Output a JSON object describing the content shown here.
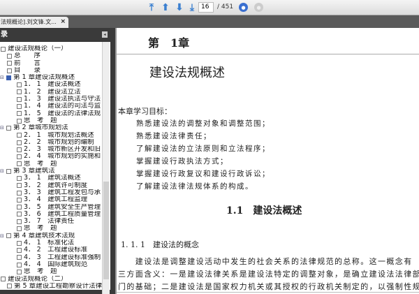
{
  "toolbar": {
    "page_current": "16",
    "page_total": "/ 451",
    "icons": [
      "first-page-icon",
      "prev-page-icon",
      "next-page-icon",
      "last-page-icon",
      "go-icon",
      "disabled-go-icon"
    ]
  },
  "tab": {
    "title": "法规概论].刘文锋.文...",
    "close": "×"
  },
  "sidebar": {
    "title": "录",
    "collapse": "◂",
    "items": [
      {
        "label": "建设法规概论（一）",
        "level": 0
      },
      {
        "label": "总　　序",
        "level": 1
      },
      {
        "label": "前　　言",
        "level": 1
      },
      {
        "label": "目　　录",
        "level": 1
      },
      {
        "label": "第 1 章建设法规概述",
        "level": 0,
        "expand": "⊟",
        "selected": true
      },
      {
        "label": "1． 1　建设法概述",
        "level": 2
      },
      {
        "label": "1． 2　建设法立法",
        "level": 2
      },
      {
        "label": "1． 3　建设法执法与守法",
        "level": 2
      },
      {
        "label": "1． 4　建设法的司法与监",
        "level": 2
      },
      {
        "label": "1． 5　建设法的法律法规",
        "level": 2
      },
      {
        "label": "思　考　题",
        "level": 2
      },
      {
        "label": "第 2 章城市规划法",
        "level": 0,
        "expand": "⊟"
      },
      {
        "label": "2． 1　城市规划法概述",
        "level": 2
      },
      {
        "label": "2． 2　城市规划的编制",
        "level": 2
      },
      {
        "label": "2． 3　城市新区开发和旧",
        "level": 2
      },
      {
        "label": "2． 4　城市规划的实施和",
        "level": 2
      },
      {
        "label": "思　考　题",
        "level": 2
      },
      {
        "label": "第 3 章建筑法",
        "level": 0,
        "expand": "⊟"
      },
      {
        "label": "3． 1　建筑法概述",
        "level": 2
      },
      {
        "label": "3． 2　建筑许可制度",
        "level": 2
      },
      {
        "label": "3． 3　建筑工程发包与承",
        "level": 2
      },
      {
        "label": "3． 4　建筑工程监理",
        "level": 2
      },
      {
        "label": "3． 5　建筑安全生产管理",
        "level": 2
      },
      {
        "label": "3． 6　建筑工程质量管理",
        "level": 2
      },
      {
        "label": "3． 7　法律责任",
        "level": 2
      },
      {
        "label": "思　考　题",
        "level": 2
      },
      {
        "label": "第 4 章建筑技术法规",
        "level": 0,
        "expand": "⊟"
      },
      {
        "label": "4． 1　标准化法",
        "level": 2
      },
      {
        "label": "4． 2　工程建设标准",
        "level": 2
      },
      {
        "label": "4． 3　工程建设标准强制",
        "level": 2
      },
      {
        "label": "4． 4　国际建筑规范",
        "level": 2
      },
      {
        "label": "思　考　题",
        "level": 2
      },
      {
        "label": "建设法规概论（二）",
        "level": 0
      },
      {
        "label": "第 5 章建设工程勘察设计法律",
        "level": 1
      }
    ]
  },
  "document": {
    "chapter": "第　1章",
    "chapter_title": "建设法规概述",
    "goals_heading": "本章学习目标：",
    "goals": [
      "熟悉建设法的调整对象和调整范围；",
      "熟悉建设法律责任；",
      "了解建设法的立法原则和立法程序；",
      "掌握建设行政执法方式；",
      "掌握建设行政复议和建设行政诉讼；",
      "了解建设法律法规体系的构成。"
    ],
    "section": "1.1　建设法概述",
    "subsection": "1. 1. 1　建设法的概念",
    "paragraph": [
      "　　建设法是调整建设活动中发生的社会关系的法律规范的总称。这一概念有",
      "三方面含义：一是建设法律关系是建设法特定的调整对象，是确立建设法法律部",
      "门的基础；二是建设法是国家权力机关或其授权的行政机关制定的，以强制性规"
    ]
  }
}
